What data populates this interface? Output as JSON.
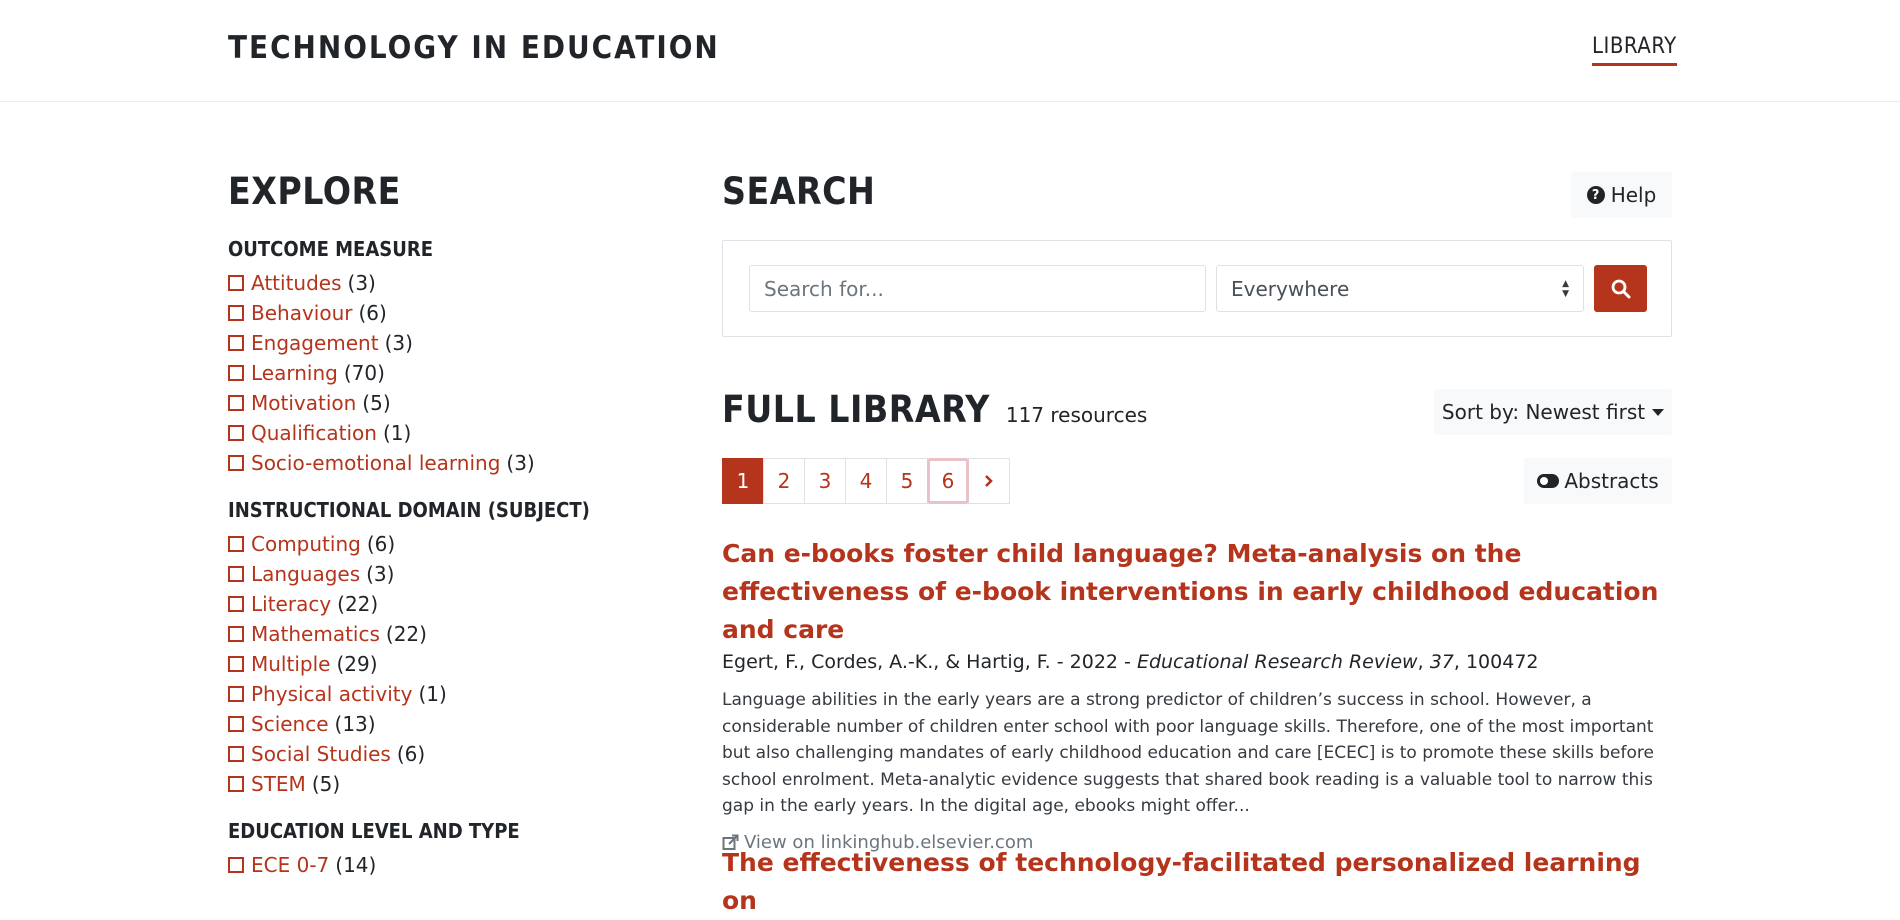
{
  "header": {
    "brand": "TECHNOLOGY IN EDUCATION",
    "nav_library": "LIBRARY"
  },
  "sidebar": {
    "title": "EXPLORE",
    "facets": [
      {
        "title": "OUTCOME MEASURE",
        "items": [
          {
            "label": "Attitudes",
            "count": "(3)"
          },
          {
            "label": "Behaviour",
            "count": "(6)"
          },
          {
            "label": "Engagement",
            "count": "(3)"
          },
          {
            "label": "Learning",
            "count": "(70)"
          },
          {
            "label": "Motivation",
            "count": "(5)"
          },
          {
            "label": "Qualification",
            "count": "(1)"
          },
          {
            "label": "Socio-emotional learning",
            "count": "(3)"
          }
        ]
      },
      {
        "title": "INSTRUCTIONAL DOMAIN (SUBJECT)",
        "items": [
          {
            "label": "Computing",
            "count": "(6)"
          },
          {
            "label": "Languages",
            "count": "(3)"
          },
          {
            "label": "Literacy",
            "count": "(22)"
          },
          {
            "label": "Mathematics",
            "count": "(22)"
          },
          {
            "label": "Multiple",
            "count": "(29)"
          },
          {
            "label": "Physical activity",
            "count": "(1)"
          },
          {
            "label": "Science",
            "count": "(13)"
          },
          {
            "label": "Social Studies",
            "count": "(6)"
          },
          {
            "label": "STEM",
            "count": "(5)"
          }
        ]
      },
      {
        "title": "EDUCATION LEVEL AND TYPE",
        "items": [
          {
            "label": "ECE 0-7",
            "count": "(14)"
          }
        ]
      }
    ]
  },
  "search": {
    "title": "SEARCH",
    "help_label": "Help",
    "placeholder": "Search for...",
    "scope_selected": "Everywhere"
  },
  "library": {
    "title": "FULL LIBRARY",
    "count_text": "117 resources",
    "sort_label": "Sort by: Newest first",
    "abstracts_label": "Abstracts",
    "pages": [
      "1",
      "2",
      "3",
      "4",
      "5",
      "6"
    ],
    "active_page": "1",
    "next_icon": "chevron-right-icon"
  },
  "results": [
    {
      "title": "Can e-books foster child language? Meta-analysis on the effectiveness of e-book interventions in early childhood education and care",
      "authors_year": "Egert, F., Cordes, A.-K., & Hartig, F. - 2022 - ",
      "journal": "Educational Research Review",
      "volume_sep": ", ",
      "volume": "37",
      "article": ", 100472",
      "abstract": "Language abilities in the early years are a strong predictor of children’s success in school. However, a considerable number of children enter school with poor language skills. Therefore, one of the most important but also challenging mandates of early childhood education and care [ECEC] is to promote these skills before school enrolment. Meta-analytic evidence suggests that shared book reading is a valuable tool to narrow this gap in the early years. In the digital age, ebooks might offer...",
      "link_text": "View on linkinghub.elsevier.com"
    },
    {
      "title": "The effectiveness of technology-facilitated personalized learning on"
    }
  ],
  "colors": {
    "accent": "#b5341c",
    "text": "#212529",
    "muted": "#6c757d",
    "light_bg": "#f8f9fa"
  }
}
